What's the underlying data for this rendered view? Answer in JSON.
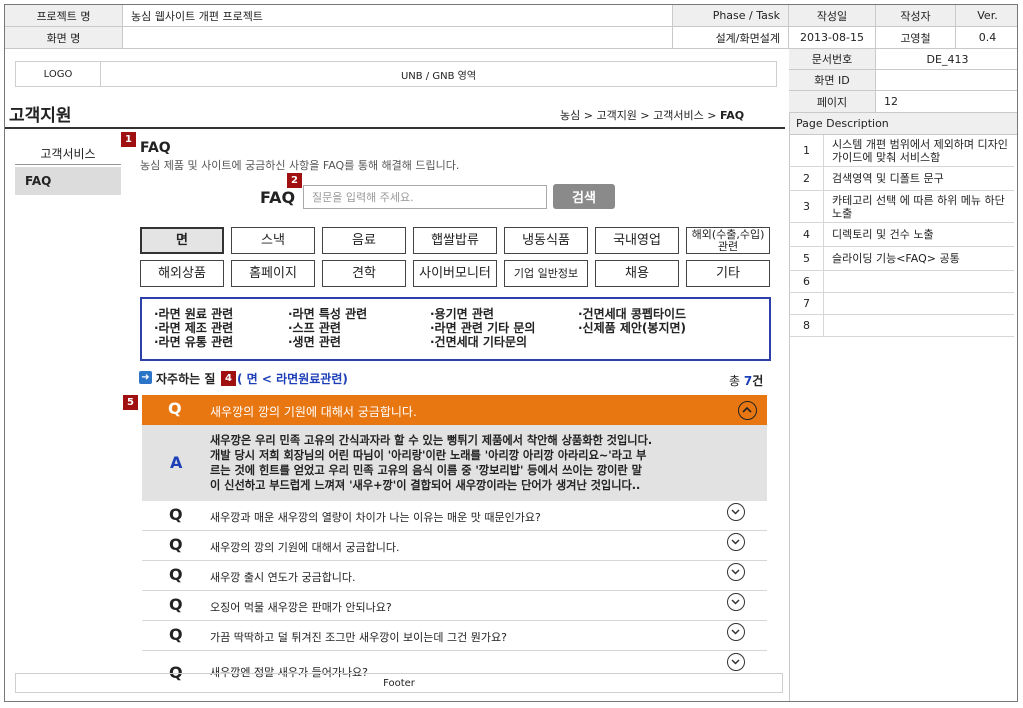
{
  "header": {
    "project_label": "프로젝트 명",
    "project_value": "농심 웹사이트 개편 프로젝트",
    "screen_label": "화면 명",
    "phase_label": "Phase / Task",
    "phase_value": "설계/화면설계",
    "author_date_label": "작성일",
    "author_label": "작성자",
    "ver_label": "Ver.",
    "date_value": "2013-08-15",
    "author_value": "고영철",
    "ver_value": "0.4",
    "doc_no_label": "문서번호",
    "doc_no_value": "DE_413",
    "screen_id_label": "화면 ID",
    "screen_id_value": "",
    "page_label": "페이지",
    "page_value": "12"
  },
  "top": {
    "logo": "LOGO",
    "nav": "UNB / GNB 영역"
  },
  "page": {
    "title": "고객지원",
    "breadcrumb_prefix": "농심 > 고객지원 > 고객서비스 > ",
    "breadcrumb_current": "FAQ"
  },
  "sidebar": {
    "items": [
      {
        "label": "고객서비스"
      },
      {
        "label": "FAQ"
      }
    ]
  },
  "faq": {
    "title": "FAQ",
    "subtitle": "농심 제품 및 사이트에 궁금하신 사항을 FAQ를 통해 해결해 드립니다.",
    "search_label": "FAQ",
    "search_placeholder": "질문을 입력해 주세요.",
    "search_button": "검색",
    "categories_row1": [
      "면",
      "스낵",
      "음료",
      "햅쌀밥류",
      "냉동식품",
      "국내영업",
      "해외(수출,수입) 관련"
    ],
    "categories_row2": [
      "해외상품",
      "홈페이지",
      "견학",
      "사이버모니터",
      "기업 일반정보",
      "채용",
      "기타"
    ],
    "subcategories": [
      [
        "·라면 원료 관련",
        "·라면 제조 관련",
        "·라면 유통 관련"
      ],
      [
        "·라면 특성 관련",
        "·스프 관련",
        "·생면 관련"
      ],
      [
        "·용기면 관련",
        "·라면 관련 기타 문의",
        "·건면세대 기타문의"
      ],
      [
        "·건면세대 콩펩타이드",
        "·신제품 제안(봉지면)",
        ""
      ]
    ],
    "list_heading": "자주하는 질",
    "list_path": "( 면 < 라면원료관련)",
    "total_prefix": "총 ",
    "total_count": "7",
    "total_suffix": "건",
    "open_question": "새우깡의 깡의 기원에 대해서 궁금합니다.",
    "answer_mark": "A",
    "question_mark": "Q",
    "answer_lines": [
      "새우깡은 우리 민족 고유의 간식과자라 할 수 있는 뻥튀기 제품에서 착안해 상품화한 것입니다.",
      "개발 당시 저희 회장님의 어린 따님이 '아리랑'이란 노래를 '아리깡 아리깡 아라리요~'라고 부",
      "르는 것에 힌트를 얻었고 우리 민족 고유의 음식 이름 중 '깡보리밥' 등에서 쓰이는 깡이란 말",
      "이 신선하고 부드럽게 느껴져 '새우+깡'이 결합되어 새우깡이라는 단어가 생겨난 것입니다.."
    ],
    "questions": [
      "새우깡과 매운 새우깡의 열량이 차이가 나는 이유는 매운 맛 때문인가요?",
      "새우깡의 깡의 기원에 대해서 궁금합니다.",
      "새우깡 출시 연도가 궁금합니다.",
      "오징어 먹물 새우깡은 판매가 안되나요?",
      "가끔 딱딱하고 덜 튀겨진 조그만 새우깡이 보이는데 그건 뭔가요?",
      "새우깡엔 정말 새우가 들어가나요?"
    ]
  },
  "badges": [
    "1",
    "2",
    "4",
    "5"
  ],
  "footer": "Footer",
  "description": {
    "title": "Page Description",
    "items": [
      {
        "num": "1",
        "text": "시스템 개편 범위에서 제외하며 디자인 가이드에 맞춰 서비스함"
      },
      {
        "num": "2",
        "text": "검색영역 및 디폴트 문구"
      },
      {
        "num": "3",
        "text": "카테고리 선택 에 따른 하위 메뉴 하단 노출"
      },
      {
        "num": "4",
        "text": "디렉토리 및 건수 노출"
      },
      {
        "num": "5",
        "text": "슬라이딩 기능<FAQ> 공통"
      },
      {
        "num": "6",
        "text": ""
      },
      {
        "num": "7",
        "text": ""
      },
      {
        "num": "8",
        "text": ""
      }
    ]
  },
  "colors": {
    "accent_orange": "#e87712",
    "badge_red": "#a01010",
    "link_blue": "#1d3fb8",
    "answer_bg": "#e2e2e2"
  }
}
